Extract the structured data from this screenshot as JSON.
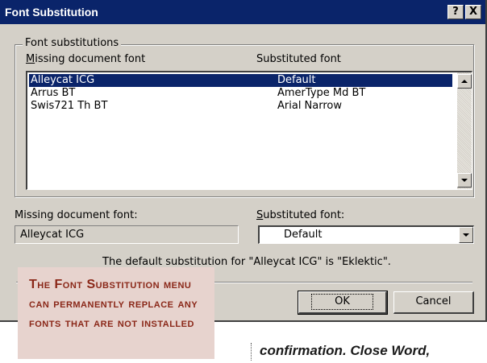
{
  "window": {
    "title": "Font Substitution",
    "help_label": "?",
    "close_label": "X"
  },
  "group": {
    "legend": "Font substitutions",
    "col_missing_key": "M",
    "col_missing_rest": "issing document font",
    "col_substituted": "Substituted font"
  },
  "list": {
    "rows": [
      {
        "missing": "Alleycat ICG",
        "substituted": "Default"
      },
      {
        "missing": "Arrus BT",
        "substituted": "AmerType Md BT"
      },
      {
        "missing": "Swis721 Th BT",
        "substituted": "Arial Narrow"
      }
    ],
    "selected_index": 0
  },
  "labels": {
    "missing_font": "Missing document font:",
    "substituted_key": "S",
    "substituted_rest": "ubstituted font:"
  },
  "fields": {
    "missing_font_value": "Alleycat ICG",
    "substituted_font_value": "Default"
  },
  "note": "The default substitution for \"Alleycat ICG\" is \"Eklektic\".",
  "buttons": {
    "ok": "OK",
    "cancel": "Cancel"
  },
  "callout": {
    "text": "The Font Substitution menu can permanently replace any fonts that are not installed"
  },
  "article": {
    "text": "confirmation. Close Word,"
  },
  "colors": {
    "title_bar": "#0a246a",
    "dialog_face": "#d4d0c8",
    "selection": "#0a246a",
    "callout_bg": "#e7d3ce",
    "callout_text": "#8a2718"
  }
}
